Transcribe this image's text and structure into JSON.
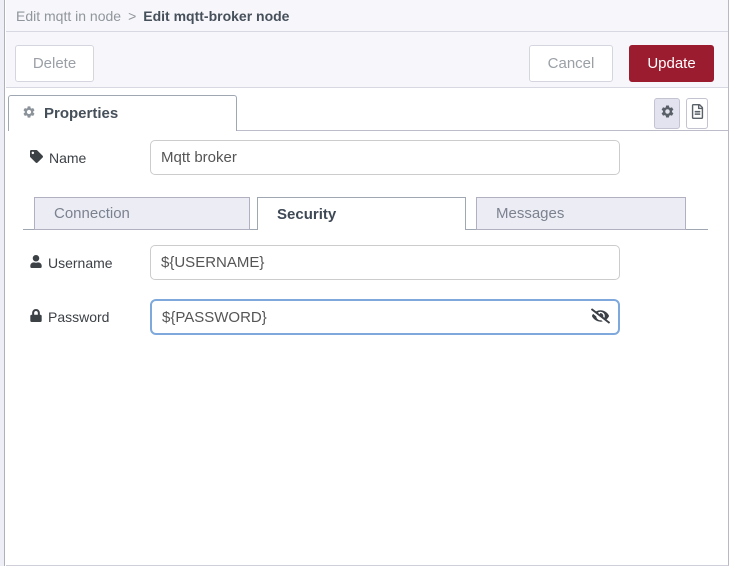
{
  "breadcrumb": {
    "parent": "Edit mqtt in node",
    "separator": ">",
    "current": "Edit mqtt-broker node"
  },
  "toolbar": {
    "delete_label": "Delete",
    "cancel_label": "Cancel",
    "update_label": "Update"
  },
  "editor_tab": {
    "properties_label": "Properties"
  },
  "fields": {
    "name": {
      "label": "Name",
      "value": "Mqtt broker"
    },
    "username": {
      "label": "Username",
      "value": "${USERNAME}"
    },
    "password": {
      "label": "Password",
      "value": "${PASSWORD}"
    }
  },
  "section_tabs": [
    {
      "label": "Connection",
      "active": false
    },
    {
      "label": "Security",
      "active": true
    },
    {
      "label": "Messages",
      "active": false
    }
  ],
  "icons": {
    "properties_tab": "gear-icon",
    "settings_button": "gear-icon",
    "docs_button": "document-icon",
    "name_field": "tag-icon",
    "username_field": "user-icon",
    "password_field": "lock-icon",
    "password_toggle": "eye-slash-icon"
  },
  "colors": {
    "accent_red": "#9b1b2f",
    "focus_blue": "#7fa9dc",
    "header_bg": "#f7f7fb",
    "tab_inactive_bg": "#ececf4"
  }
}
